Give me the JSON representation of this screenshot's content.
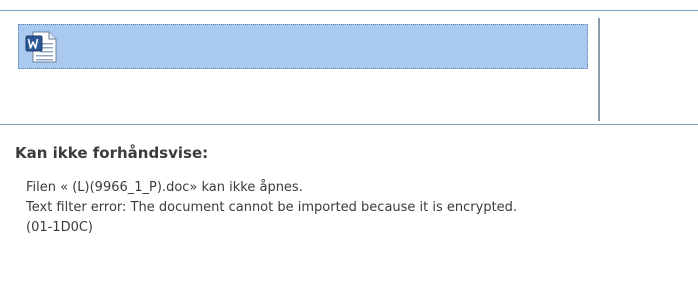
{
  "file_item": {
    "icon": "word-document-icon"
  },
  "preview": {
    "title": "Kan ikke forhåndsvise:",
    "lines": [
      "Filen « (L)(9966_1_P).doc» kan ikke åpnes.",
      "Text filter error: The document cannot be imported because it is encrypted.",
      "(01-1D0C)"
    ]
  },
  "colors": {
    "selection": "#a9c9ee",
    "rule": "#7fa2c7",
    "word_blue": "#2b5797"
  }
}
